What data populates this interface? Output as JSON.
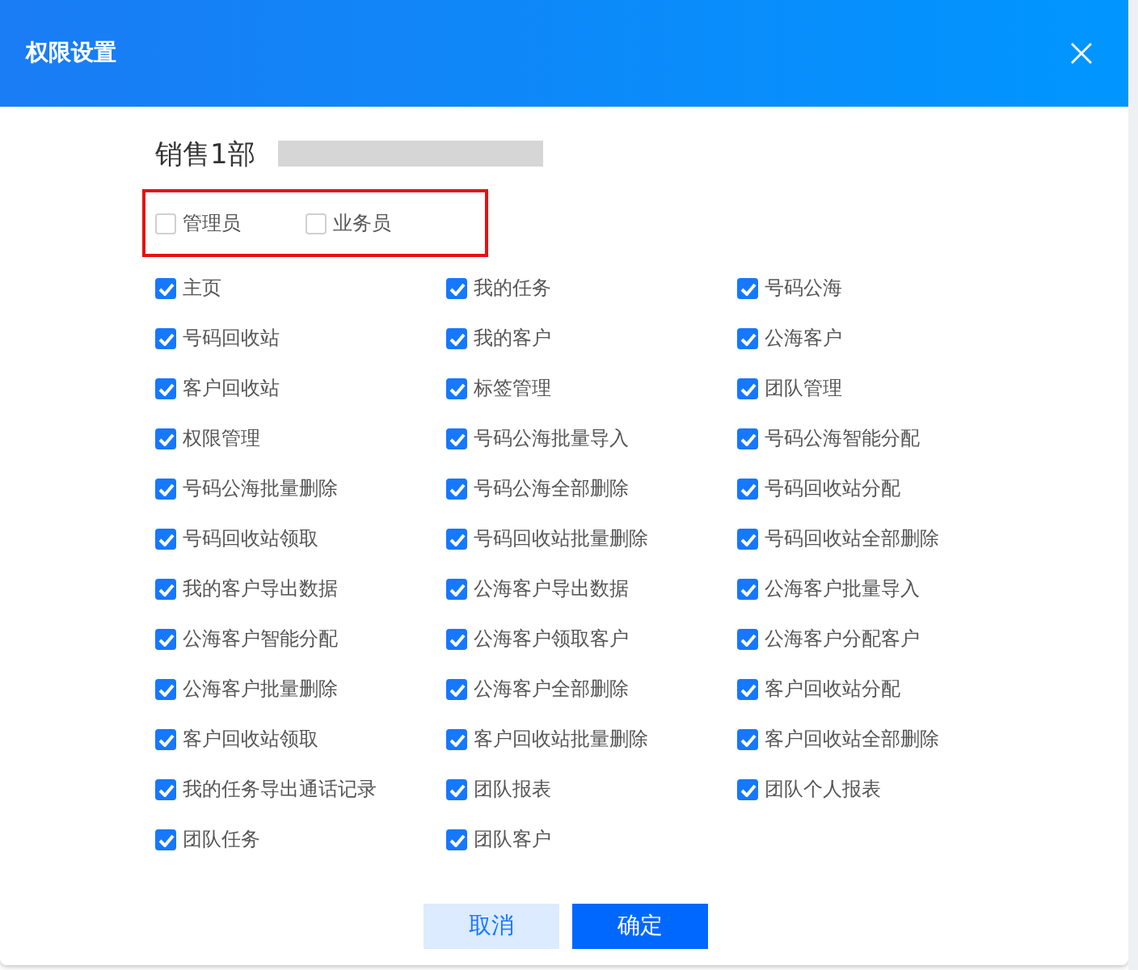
{
  "dialog": {
    "title": "权限设置"
  },
  "department": {
    "name": "销售1部"
  },
  "roles": [
    {
      "label": "管理员",
      "checked": false
    },
    {
      "label": "业务员",
      "checked": false
    }
  ],
  "permissions": [
    {
      "label": "主页",
      "checked": true
    },
    {
      "label": "我的任务",
      "checked": true
    },
    {
      "label": "号码公海",
      "checked": true
    },
    {
      "label": "号码回收站",
      "checked": true
    },
    {
      "label": "我的客户",
      "checked": true
    },
    {
      "label": "公海客户",
      "checked": true
    },
    {
      "label": "客户回收站",
      "checked": true
    },
    {
      "label": "标签管理",
      "checked": true
    },
    {
      "label": "团队管理",
      "checked": true
    },
    {
      "label": "权限管理",
      "checked": true
    },
    {
      "label": "号码公海批量导入",
      "checked": true
    },
    {
      "label": "号码公海智能分配",
      "checked": true
    },
    {
      "label": "号码公海批量删除",
      "checked": true
    },
    {
      "label": "号码公海全部删除",
      "checked": true
    },
    {
      "label": "号码回收站分配",
      "checked": true
    },
    {
      "label": "号码回收站领取",
      "checked": true
    },
    {
      "label": "号码回收站批量删除",
      "checked": true
    },
    {
      "label": "号码回收站全部删除",
      "checked": true
    },
    {
      "label": "我的客户导出数据",
      "checked": true
    },
    {
      "label": "公海客户导出数据",
      "checked": true
    },
    {
      "label": "公海客户批量导入",
      "checked": true
    },
    {
      "label": "公海客户智能分配",
      "checked": true
    },
    {
      "label": "公海客户领取客户",
      "checked": true
    },
    {
      "label": "公海客户分配客户",
      "checked": true
    },
    {
      "label": "公海客户批量删除",
      "checked": true
    },
    {
      "label": "公海客户全部删除",
      "checked": true
    },
    {
      "label": "客户回收站分配",
      "checked": true
    },
    {
      "label": "客户回收站领取",
      "checked": true
    },
    {
      "label": "客户回收站批量删除",
      "checked": true
    },
    {
      "label": "客户回收站全部删除",
      "checked": true
    },
    {
      "label": "我的任务导出通话记录",
      "checked": true
    },
    {
      "label": "团队报表",
      "checked": true
    },
    {
      "label": "团队个人报表",
      "checked": true
    },
    {
      "label": "团队任务",
      "checked": true
    },
    {
      "label": "团队客户",
      "checked": true
    }
  ],
  "buttons": {
    "cancel": "取消",
    "confirm": "确定"
  }
}
